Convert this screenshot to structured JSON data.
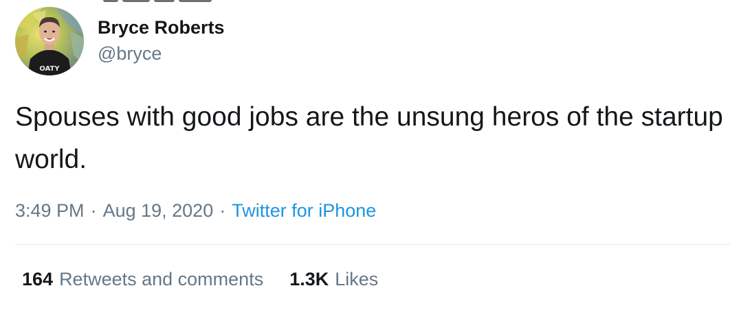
{
  "author": {
    "name": "Bryce Roberts",
    "handle": "@bryce",
    "avatar_shirt_text": "OATY"
  },
  "tweet": {
    "text": "Spouses with good jobs are the unsung heros of the startup world.",
    "time": "3:49 PM",
    "date": "Aug 19, 2020",
    "separator": "·",
    "source": "Twitter for iPhone"
  },
  "stats": {
    "retweets_count": "164",
    "retweets_label": "Retweets and comments",
    "likes_count": "1.3K",
    "likes_label": "Likes"
  },
  "colors": {
    "text": "#14171a",
    "secondary": "#657786",
    "link": "#1b95e0",
    "divider": "#e1e8ed"
  }
}
